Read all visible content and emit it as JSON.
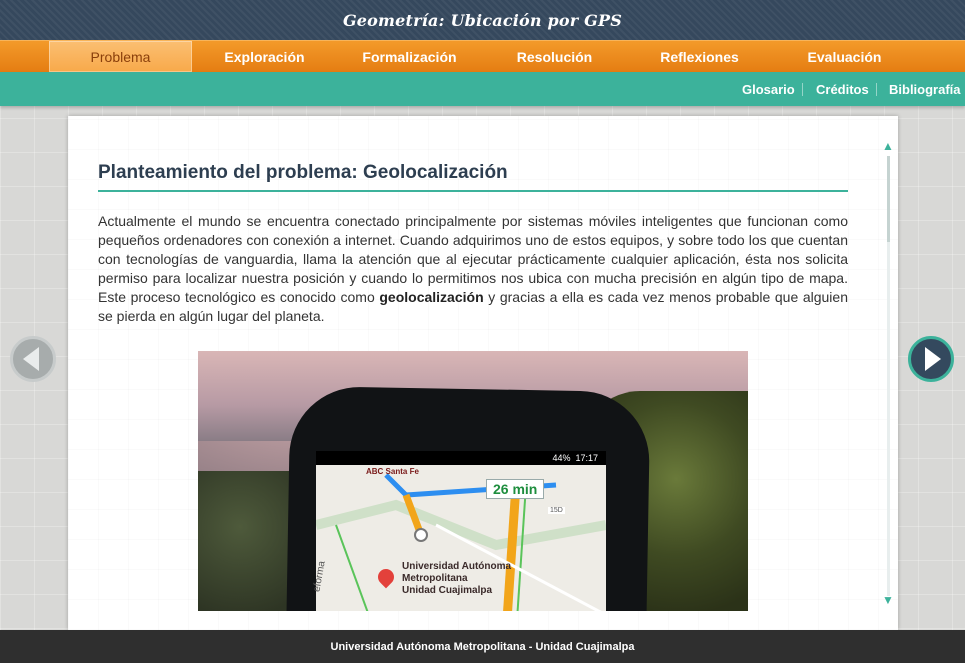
{
  "header": {
    "title": "Geometría: Ubicación por GPS"
  },
  "main_nav": {
    "tabs": [
      {
        "label": "Problema",
        "active": true
      },
      {
        "label": "Exploración",
        "active": false
      },
      {
        "label": "Formalización",
        "active": false
      },
      {
        "label": "Resolución",
        "active": false
      },
      {
        "label": "Reflexiones",
        "active": false
      },
      {
        "label": "Evaluación",
        "active": false
      }
    ]
  },
  "sub_nav": {
    "links": [
      {
        "label": "Glosario"
      },
      {
        "label": "Créditos"
      },
      {
        "label": "Bibliografía"
      }
    ]
  },
  "content": {
    "heading": "Planteamiento del problema: Geolocalización",
    "paragraph_before": "Actualmente el mundo se encuentra conectado principalmente por sistemas móviles inteligentes que funcionan como pequeños ordenadores con conexión a internet. Cuando adquirimos uno de estos equipos, y sobre todo los que cuentan con tecnologías de vanguardia, llama la atención que al ejecutar prácticamente cualquier aplicación, ésta nos solicita permiso para localizar nuestra posición y cuando lo permitimos nos ubica con mucha precisión en algún tipo de mapa. Este proceso tecnológico es conocido como",
    "paragraph_bold": "geolocalización",
    "paragraph_after": "y gracias a ella es cada vez menos probable que alguien se pierda en algún lugar del planeta.",
    "image": {
      "status_time": "17:17",
      "battery": "44%",
      "street_label": "ABC Santa Fe",
      "eta": "26 min",
      "route_badge": "15D",
      "map_place_line1": "Universidad Autónoma",
      "map_place_line2": "Metropolitana",
      "map_place_line3": "Unidad Cuajimalpa",
      "side_street": "eforma"
    }
  },
  "icons": {
    "prev": "arrow-left-icon",
    "next": "arrow-right-icon",
    "scroll_up": "scroll-up-icon",
    "scroll_down": "scroll-down-icon"
  },
  "colors": {
    "header_bg": "#35485d",
    "nav_orange": "#e57d12",
    "nav_active": "#f8a94a",
    "teal": "#3cb29b",
    "footer_bg": "#2f2f2f"
  },
  "footer": {
    "text": "Universidad Autónoma Metropolitana - Unidad Cuajimalpa"
  }
}
